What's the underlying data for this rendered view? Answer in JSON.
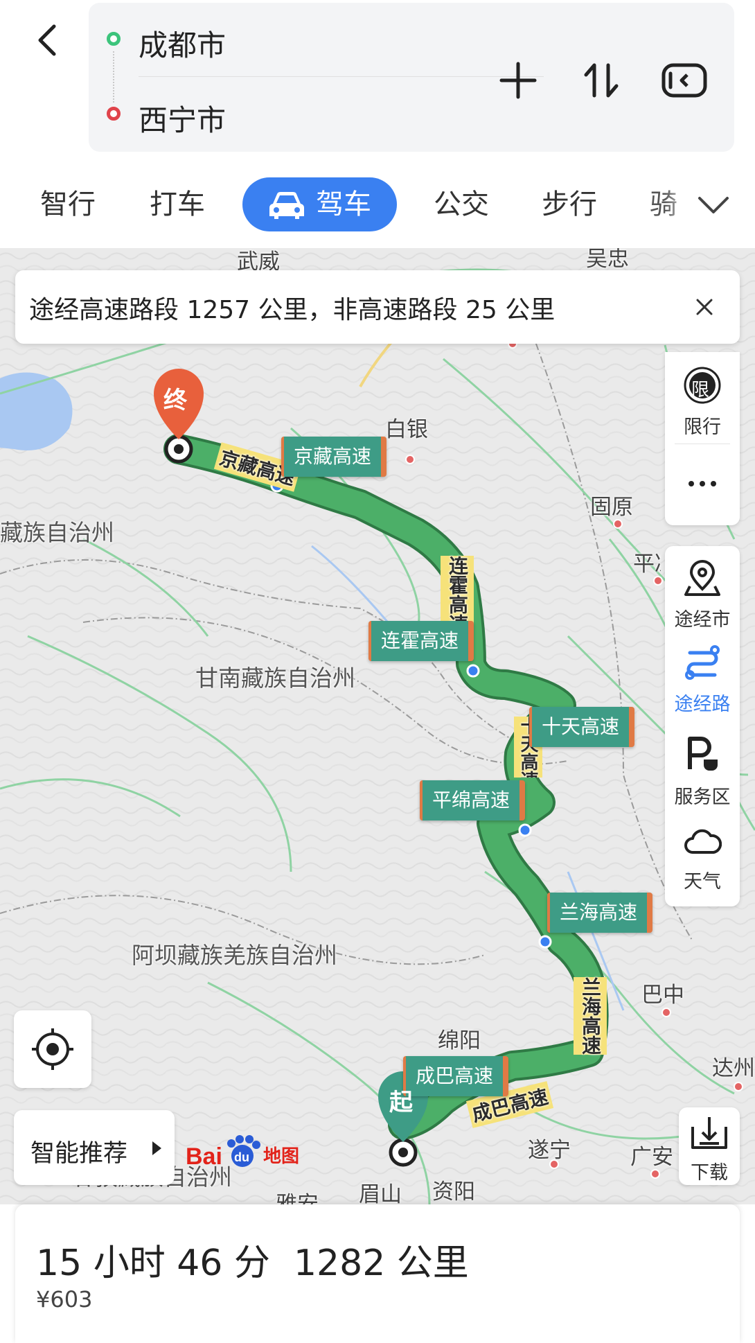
{
  "header": {
    "start_city": "成都市",
    "end_city": "西宁市",
    "back_icon": "chevron-left-icon",
    "add_icon": "plus-icon",
    "swap_icon": "swap-vertical-icon",
    "vr_icon": "vr-headset-icon",
    "colors": {
      "start_dot": "#3cc47c",
      "end_dot": "#e0434b",
      "box_bg": "#f3f4f6"
    }
  },
  "tabs": {
    "items": [
      "智行",
      "打车",
      "驾车",
      "公交",
      "步行",
      "骑"
    ],
    "active_index": 2,
    "active_icon": "car-icon",
    "more_icon": "chevron-down-icon",
    "active_color": "#3a80f1"
  },
  "notice": {
    "text": "途经高速路段 1257 公里，非高速路段 25 公里",
    "close_icon": "close-icon"
  },
  "map": {
    "markers": {
      "start": "起",
      "end": "终"
    },
    "road_labels": [
      "京藏高速",
      "连霍高速",
      "十天高速",
      "平绵高速",
      "兰海高速",
      "成巴高速"
    ],
    "route_text": [
      "京藏高速",
      "连霍高速",
      "兰海高速",
      "成巴高速",
      "十天高速"
    ],
    "places": [
      "武威",
      "吴忠",
      "白银",
      "固原",
      "平凉",
      "藏族自治州",
      "甘南藏族自治州",
      "阿坝藏族羌族自治州",
      "绵阳",
      "巴中",
      "达州",
      "遂宁",
      "广安",
      "眉山",
      "资阳",
      "雅安",
      "甘孜藏族自治州"
    ],
    "route_color": "#4caf68",
    "logo_text": "地图"
  },
  "side_panel": {
    "top": [
      {
        "label": "限行",
        "icon": "restriction-icon"
      },
      {
        "label": "",
        "icon": "more-dots-icon"
      }
    ],
    "bottom": [
      {
        "label": "途经市",
        "icon": "map-pin-icon"
      },
      {
        "label": "途经路",
        "icon": "route-icon",
        "active": true
      },
      {
        "label": "服务区",
        "icon": "service-area-icon"
      },
      {
        "label": "天气",
        "icon": "cloud-icon"
      }
    ],
    "restriction_glyph": "限"
  },
  "controls": {
    "locate_icon": "locate-icon",
    "smart_label": "智能推荐",
    "download_label": "下载",
    "download_icon": "download-icon"
  },
  "summary": {
    "duration": "15 小时 46 分",
    "distance": "1282 公里",
    "fee": "¥603"
  }
}
